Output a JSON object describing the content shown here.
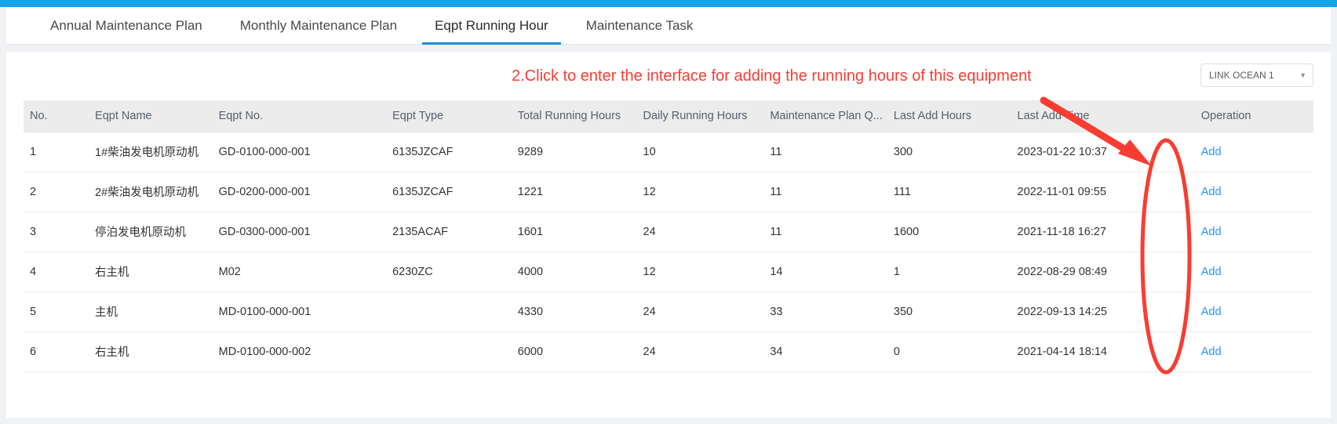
{
  "theme": {
    "accent": "#17a3e8",
    "tab_active_underline": "#1890d4",
    "annotation_red": "#fa3c32",
    "link_blue": "#2196f3",
    "header_bg": "#ececec"
  },
  "tabs": [
    {
      "label": "Annual Maintenance Plan",
      "active": false
    },
    {
      "label": "Monthly Maintenance Plan",
      "active": false
    },
    {
      "label": "Eqpt Running Hour",
      "active": true
    },
    {
      "label": "Maintenance Task",
      "active": false
    }
  ],
  "annotation": {
    "text": "2.Click to enter the interface for adding the running hours of this equipment",
    "arrow": "red-arrow",
    "ellipse": "red-ellipse-highlight"
  },
  "vessel_select": {
    "value": "LINK OCEAN 1",
    "caret": "chevron-down-icon"
  },
  "table": {
    "columns": [
      "No.",
      "Eqpt Name",
      "Eqpt No.",
      "Eqpt Type",
      "Total Running Hours",
      "Daily Running Hours",
      "Maintenance Plan Q...",
      "Last Add Hours",
      "Last Add Time",
      "Operation"
    ],
    "action_label": "Add",
    "rows": [
      {
        "no": "1",
        "eqpt_name": "1#柴油发电机原动机",
        "eqpt_no": "GD-0100-000-001",
        "eqpt_type": "6135JZCAF",
        "total_running_hours": "9289",
        "daily_running_hours": "10",
        "maintenance_plan_q": "11",
        "last_add_hours": "300",
        "last_add_time": "2023-01-22 10:37",
        "operation": "Add"
      },
      {
        "no": "2",
        "eqpt_name": "2#柴油发电机原动机",
        "eqpt_no": "GD-0200-000-001",
        "eqpt_type": "6135JZCAF",
        "total_running_hours": "1221",
        "daily_running_hours": "12",
        "maintenance_plan_q": "11",
        "last_add_hours": "111",
        "last_add_time": "2022-11-01 09:55",
        "operation": "Add"
      },
      {
        "no": "3",
        "eqpt_name": "停泊发电机原动机",
        "eqpt_no": "GD-0300-000-001",
        "eqpt_type": "2135ACAF",
        "total_running_hours": "1601",
        "daily_running_hours": "24",
        "maintenance_plan_q": "11",
        "last_add_hours": "1600",
        "last_add_time": "2021-11-18 16:27",
        "operation": "Add"
      },
      {
        "no": "4",
        "eqpt_name": "右主机",
        "eqpt_no": "M02",
        "eqpt_type": "6230ZC",
        "total_running_hours": "4000",
        "daily_running_hours": "12",
        "maintenance_plan_q": "14",
        "last_add_hours": "1",
        "last_add_time": "2022-08-29 08:49",
        "operation": "Add"
      },
      {
        "no": "5",
        "eqpt_name": "主机",
        "eqpt_no": "MD-0100-000-001",
        "eqpt_type": "",
        "total_running_hours": "4330",
        "daily_running_hours": "24",
        "maintenance_plan_q": "33",
        "last_add_hours": "350",
        "last_add_time": "2022-09-13 14:25",
        "operation": "Add"
      },
      {
        "no": "6",
        "eqpt_name": "右主机",
        "eqpt_no": "MD-0100-000-002",
        "eqpt_type": "",
        "total_running_hours": "6000",
        "daily_running_hours": "24",
        "maintenance_plan_q": "34",
        "last_add_hours": "0",
        "last_add_time": "2021-04-14 18:14",
        "operation": "Add"
      }
    ]
  }
}
